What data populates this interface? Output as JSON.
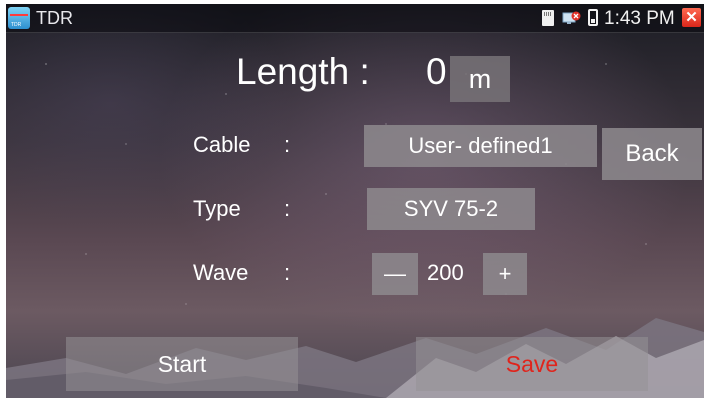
{
  "titlebar": {
    "app_title": "TDR",
    "time": "1:43 PM",
    "close_glyph": "✕",
    "app_icon_text": "TDR"
  },
  "main": {
    "length_label": "Length :",
    "length_value": "0",
    "length_unit": "m",
    "cable": {
      "label": "Cable",
      "colon": ":",
      "value": "User- defined1"
    },
    "back_label": "Back",
    "type": {
      "label": "Type",
      "colon": ":",
      "value": "SYV 75-2"
    },
    "wave": {
      "label": "Wave",
      "colon": ":",
      "minus": "—",
      "value": "200",
      "plus": "+"
    }
  },
  "footer": {
    "start_label": "Start",
    "save_label": "Save"
  },
  "colors": {
    "save_text": "#e0241c",
    "close_button": "#e0241c",
    "button_bg": "#8c878c"
  },
  "icons": {
    "app": "tdr-app-icon",
    "storage": "sd-card-icon",
    "network": "network-icon",
    "battery": "battery-icon",
    "close": "close-icon"
  }
}
